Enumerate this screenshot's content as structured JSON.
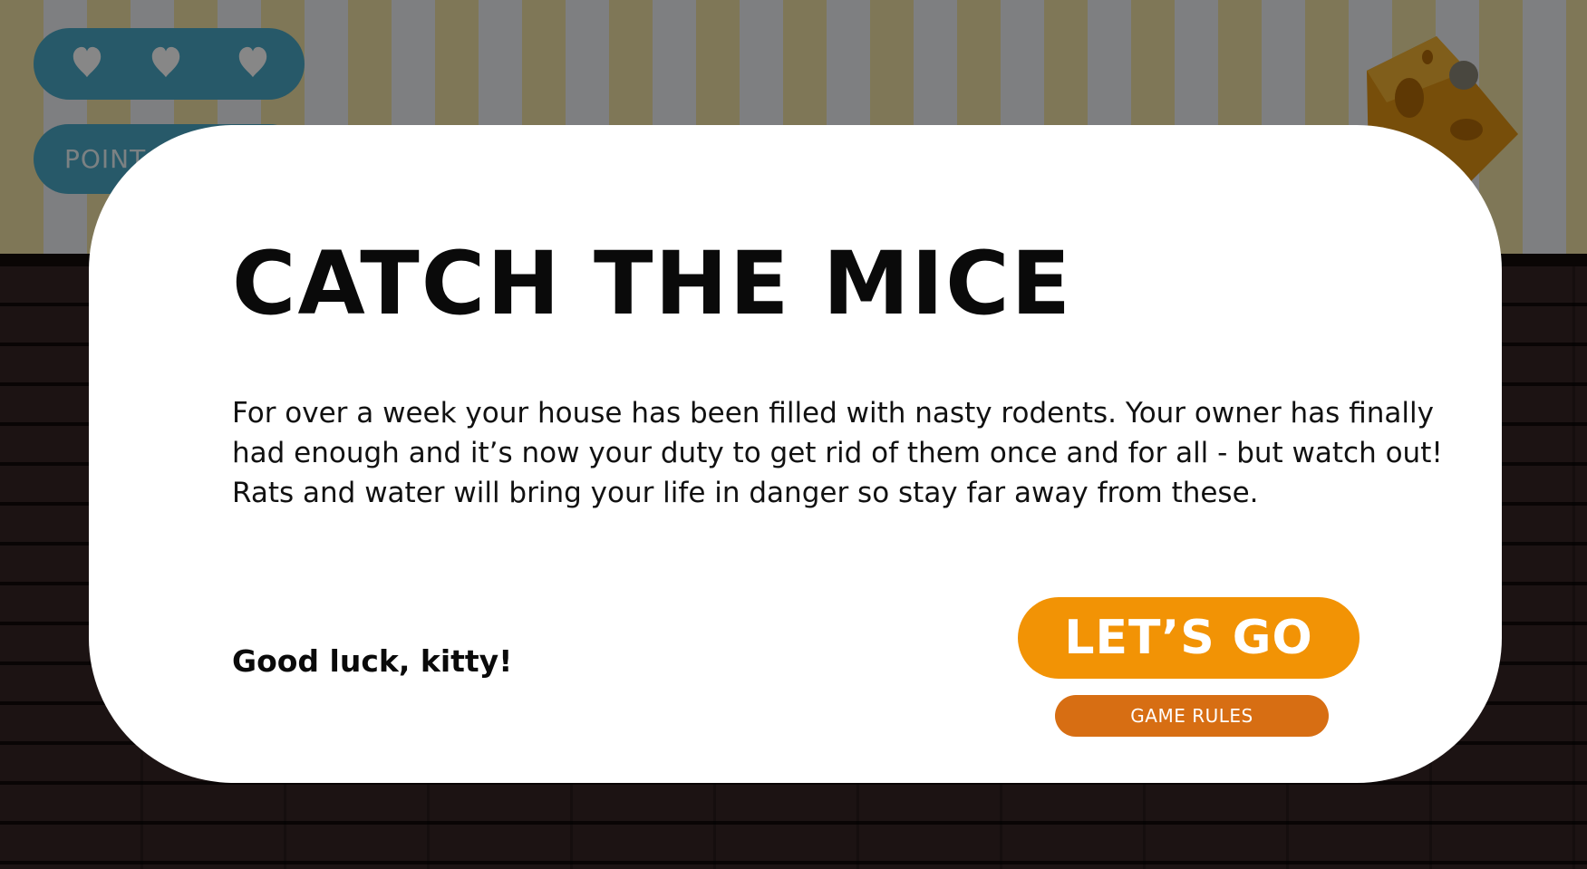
{
  "hud": {
    "lives": 3,
    "points_label": "POINT"
  },
  "modal": {
    "title": "CATCH THE MICE",
    "body": "For over a week your house has been filled with nasty rodents. Your owner has finally had enough and it’s now your duty to get rid of them once and for all - but watch out! Rats and water will bring your life in danger so stay far away from these.",
    "signoff": "Good luck, kitty!",
    "primary_button": "LET’S GO",
    "secondary_button": "GAME RULES"
  },
  "colors": {
    "hud_pill": "#4aa8c6",
    "primary_button": "#f29305",
    "secondary_button": "#d76e13",
    "modal_background": "#ffffff",
    "wallpaper_stripe_yellow": "#f0e1a4",
    "wallpaper_stripe_white": "#eef0f4",
    "floor": "#352524"
  },
  "icons": {
    "life": "heart-icon",
    "collectible": "cheese-icon"
  }
}
